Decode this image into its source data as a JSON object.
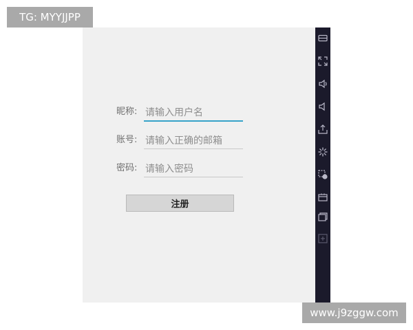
{
  "tag_label": "TG: MYYJJPP",
  "watermark": "www.j9zggw.com",
  "form": {
    "nickname": {
      "label": "昵称:",
      "placeholder": "请输入用户名"
    },
    "account": {
      "label": "账号:",
      "placeholder": "请输入正确的邮箱"
    },
    "password": {
      "label": "密码:",
      "placeholder": "请输入密码"
    },
    "register_label": "注册"
  },
  "toolbar": {
    "icons": [
      "display-icon",
      "fullscreen-icon",
      "volume-up-icon",
      "volume-down-icon",
      "install-apk-icon",
      "loading-icon",
      "screenshot-icon",
      "folder-icon",
      "multi-window-icon",
      "add-icon"
    ]
  },
  "colors": {
    "screen_background": "#f0f0f0",
    "toolbar_background": "#1b1a2b",
    "focus_underline": "#35a2c9",
    "button_background": "#d6d6d6"
  }
}
